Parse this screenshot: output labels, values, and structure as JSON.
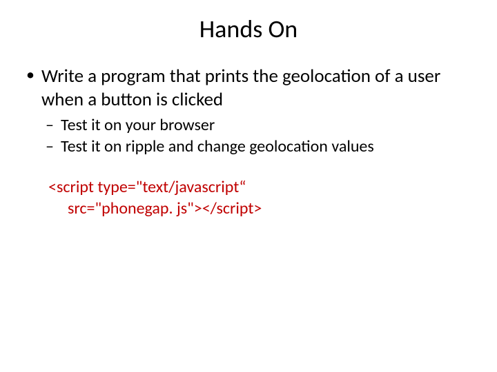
{
  "title": "Hands On",
  "bullets": {
    "main": "Write a program that prints the geolocation of a user when a button is clicked",
    "sub1": "Test it on your browser",
    "sub2": "Test it on ripple and change geolocation values"
  },
  "code": {
    "line1": "<script type=\"text/javascript“",
    "line2": "src=\"phonegap. js\"></script>"
  }
}
